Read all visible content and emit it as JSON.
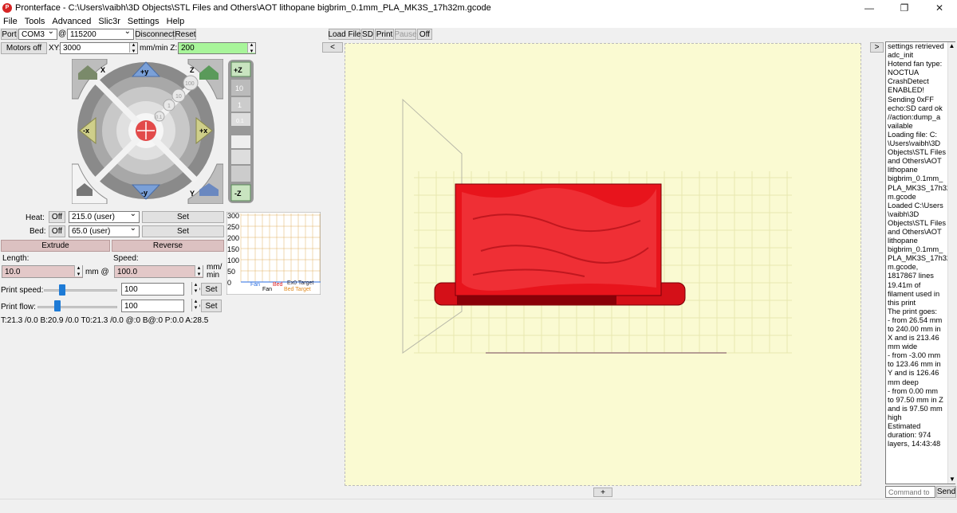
{
  "window": {
    "title": "Pronterface - C:\\Users\\vaibh\\3D Objects\\STL Files and Others\\AOT lithopane bigbrim_0.1mm_PLA_MK3S_17h32m.gcode",
    "minimize": "—",
    "maximize": "❐",
    "close": "✕"
  },
  "menu": [
    "File",
    "Tools",
    "Advanced",
    "Slic3r",
    "Settings",
    "Help"
  ],
  "toolbar": {
    "port_label": "Port",
    "port_value": "COM3",
    "at_label": "@",
    "baud_value": "115200",
    "disconnect_label": "Disconnect",
    "reset_label": "Reset",
    "motors_off_label": "Motors off",
    "xy_label": "XY:",
    "xy_value": "3000",
    "mm_min_z_label": "mm/min Z:",
    "z_value": "200"
  },
  "jog": {
    "home_x": "X",
    "home_y": "Y",
    "home_z": "Z",
    "plus_y": "+y",
    "minus_y": "-y",
    "minus_x": "-x",
    "plus_x": "+x",
    "plus_z": "+Z",
    "minus_z": "-Z",
    "step_100": "100",
    "step_10": "10",
    "step_1": "1",
    "step_01": "0.1",
    "zstep_10": "10",
    "zstep_1": "1",
    "zstep_01": "0.1"
  },
  "temps": {
    "heat_label": "Heat:",
    "heat_off": "Off",
    "heat_value": "215.0 (user)",
    "heat_set": "Set",
    "bed_label": "Bed:",
    "bed_off": "Off",
    "bed_value": "65.0 (user)",
    "bed_set": "Set"
  },
  "extrude": {
    "extrude_label": "Extrude",
    "reverse_label": "Reverse",
    "length_label": "Length:",
    "speed_label": "Speed:",
    "length_value": "10.0",
    "mm_at": "mm @",
    "speed_value": "100.0",
    "mm_min": "mm/\nmin"
  },
  "print_speed": {
    "label": "Print speed:",
    "value": "100",
    "level": 0.25,
    "pct": "%",
    "set": "Set"
  },
  "print_flow": {
    "label": "Print flow:",
    "value": "100",
    "level": 0.25,
    "pct": "%",
    "set": "Set"
  },
  "status_line": "T:21.3 /0.0 B:20.9 /0.0 T0:21.3 /0.0 @:0 B@:0 P:0.0 A:28.5",
  "graph": {
    "ticks": [
      "300",
      "250",
      "200",
      "150",
      "100",
      "50",
      "0"
    ],
    "legend": [
      "Fan",
      "Bed",
      "Bed Target",
      "Ex0 Target",
      "Ex0"
    ]
  },
  "viewer_toolbar": {
    "load_file": "Load File",
    "sd": "SD",
    "print": "Print",
    "pause": "Pause",
    "off": "Off",
    "left_arrow": "<",
    "right_arrow": ">",
    "bottom_plus": "+"
  },
  "log_lines": [
    "settings retrieved",
    "adc_init",
    "Hotend fan type:",
    "NOCTUA",
    "CrashDetect",
    "ENABLED!",
    "Sending 0xFF",
    "echo:SD card ok",
    "//action:dump_a",
    "vailable",
    "Loading file: C:",
    "\\Users\\vaibh\\3D",
    "Objects\\STL Files",
    "and Others\\AOT",
    "lithopane",
    "bigbrim_0.1mm_",
    "PLA_MK3S_17h32",
    "m.gcode",
    "Loaded C:\\Users",
    "\\vaibh\\3D",
    "Objects\\STL Files",
    "and Others\\AOT",
    "lithopane",
    "bigbrim_0.1mm_",
    "PLA_MK3S_17h32",
    "m.gcode,",
    "1817867 lines",
    "19.41m of",
    "filament used in",
    "this print",
    "The print goes:",
    "- from 26.54 mm",
    "to 240.00 mm in",
    "X and is 213.46",
    "mm wide",
    "- from -3.00 mm",
    "to 123.46 mm in",
    "Y and is 126.46",
    "mm deep",
    "- from 0.00 mm",
    "to 97.50 mm in Z",
    "and is 97.50 mm",
    "high",
    "Estimated",
    "duration: 974",
    "layers, 14:43:48"
  ],
  "command": {
    "placeholder": "Command to",
    "send_label": "Send"
  },
  "colors": {
    "accent_green": "#a8f59a",
    "model_red": "#e8141c",
    "viewport_bg": "#fafad2",
    "pink_button": "#dcc1c1"
  }
}
